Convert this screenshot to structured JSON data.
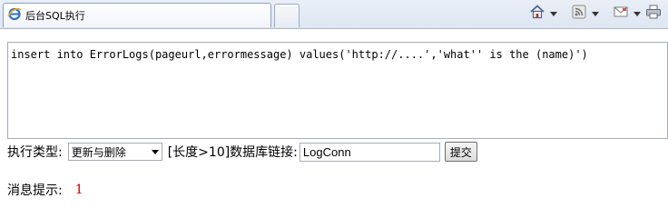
{
  "browser": {
    "tab_title": "后台SQL执行",
    "toolbar_icons": [
      "home-icon",
      "rss-feed-icon",
      "mail-icon",
      "print-icon"
    ]
  },
  "sql": {
    "value": "insert into ErrorLogs(pageurl,errormessage) values('http://....','what'' is the (name)')"
  },
  "form": {
    "type_label": "执行类型:",
    "type_selected": "更新与删除",
    "conn_label": "[长度>10]数据库链接:",
    "conn_value": "LogConn",
    "submit_label": "提交"
  },
  "message": {
    "label": "消息提示:",
    "value": "1"
  }
}
